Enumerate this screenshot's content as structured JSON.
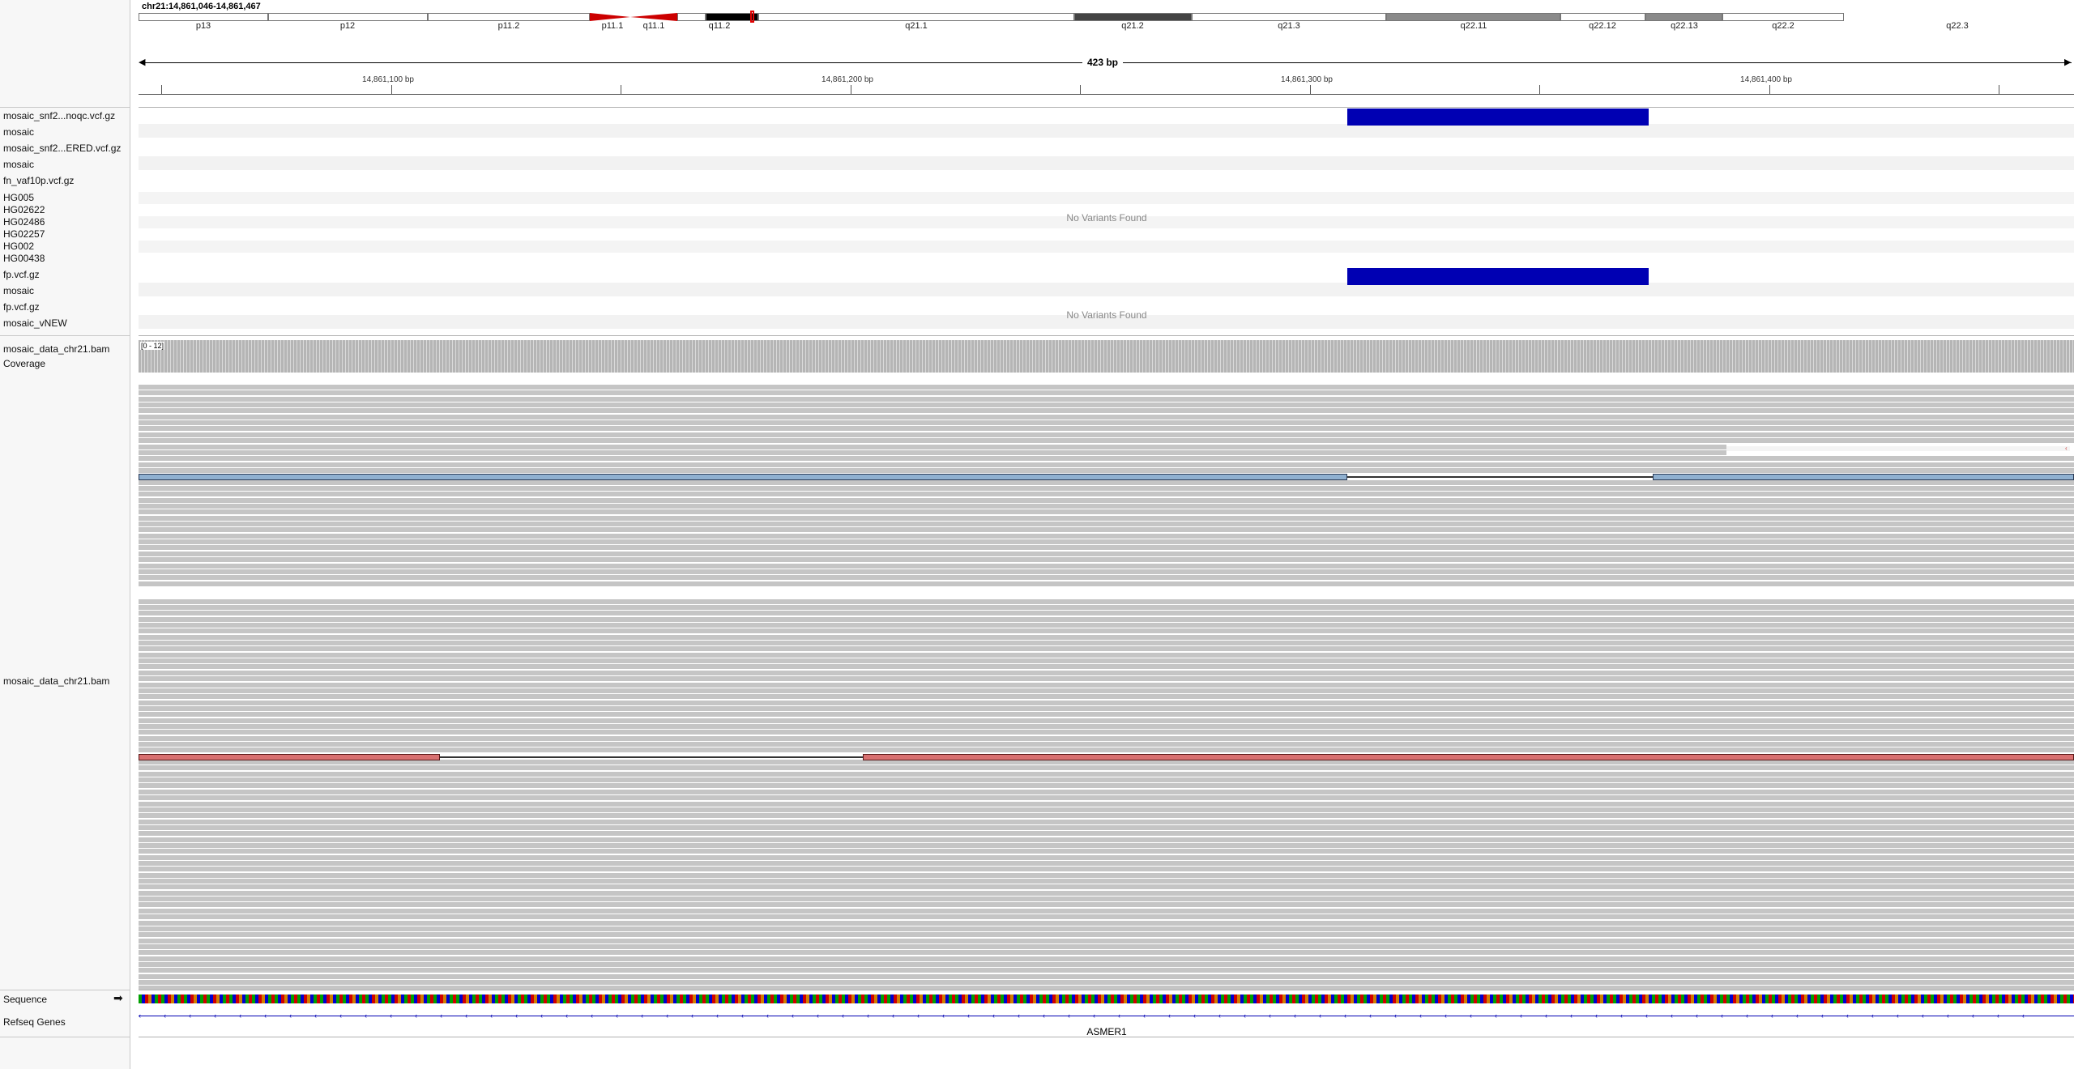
{
  "locus": "chr21:14,861,046-14,861,467",
  "span_label": "423 bp",
  "ideogram": {
    "bands": [
      {
        "label": "p13",
        "color": "#ffffff"
      },
      {
        "label": "p12",
        "color": "#ffffff"
      },
      {
        "label": "p11.2",
        "color": "#ffffff"
      },
      {
        "label": "p11.1",
        "color": "#cc0000"
      },
      {
        "label": "q11.1",
        "color": "#cc0000"
      },
      {
        "label": "q11.2",
        "color": "#ffffff"
      },
      {
        "label": "q21.1",
        "color": "#000000"
      },
      {
        "label": "q21.2",
        "color": "#ffffff"
      },
      {
        "label": "q21.3",
        "color": "#444444"
      },
      {
        "label": "q22.11",
        "color": "#ffffff"
      },
      {
        "label": "q22.12",
        "color": "#8a8a8a"
      },
      {
        "label": "q22.13",
        "color": "#ffffff"
      },
      {
        "label": "q22.2",
        "color": "#8a8a8a"
      },
      {
        "label": "q22.3",
        "color": "#ffffff"
      }
    ]
  },
  "ruler": {
    "labels": [
      "14,861,100 bp",
      "14,861,200 bp",
      "14,861,300 bp",
      "14,861,400 bp"
    ]
  },
  "tracks": {
    "names": [
      "mosaic_snf2...noqc.vcf.gz",
      "mosaic",
      "mosaic_snf2...ERED.vcf.gz",
      "mosaic",
      "fn_vaf10p.vcf.gz",
      "HG005",
      "HG02622",
      "HG02486",
      "HG02257",
      "HG002",
      "HG00438",
      "fp.vcf.gz",
      "mosaic",
      "fp.vcf.gz",
      "mosaic_vNEW"
    ],
    "coverage_name": "mosaic_data_chr21.bam Coverage",
    "coverage_range": "[0 - 12]",
    "bam_name": "mosaic_data_chr21.bam",
    "sequence_name": "Sequence",
    "sequence_arrow": "➡",
    "refseq_name": "Refseq Genes",
    "gene_name": "ASMER1",
    "no_variants_1": "No Variants Found",
    "no_variants_2": "No Variants Found"
  },
  "colors": {
    "variant_blue": "#0000b3",
    "read_gray": "#c5c5c5",
    "insert_blue": "#8fb0d0",
    "insert_red": "#d87070",
    "centromere_red": "#cc0000"
  }
}
